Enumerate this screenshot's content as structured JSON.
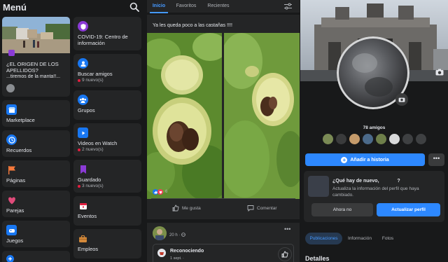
{
  "menu": {
    "title": "Menú",
    "news_card": {
      "title": "¿EL ORIGEN DE LOS APELLIDOS?",
      "subtitle": "...tiremos de la manta!!..."
    },
    "cards_left": [
      {
        "label": "Marketplace",
        "icon": "marketplace-icon"
      },
      {
        "label": "Recuerdos",
        "icon": "memories-icon"
      },
      {
        "label": "Páginas",
        "icon": "pages-flag-icon"
      },
      {
        "label": "Parejas",
        "icon": "dating-heart-icon"
      },
      {
        "label": "Juegos",
        "icon": "gaming-icon"
      }
    ],
    "cards_right": [
      {
        "label": "COVID-19: Centro de información",
        "icon": "covid-info-icon",
        "sub": ""
      },
      {
        "label": "Buscar amigos",
        "icon": "find-friends-icon",
        "sub": "9 nuevo(s)"
      },
      {
        "label": "Grupos",
        "icon": "groups-icon",
        "sub": ""
      },
      {
        "label": "Videos en Watch",
        "icon": "watch-video-icon",
        "sub": "2 nuevo(s)"
      },
      {
        "label": "Guardado",
        "icon": "saved-bookmark-icon",
        "sub": "3 nuevo(s)"
      },
      {
        "label": "Eventos",
        "icon": "events-calendar-icon",
        "sub": ""
      },
      {
        "label": "Empleos",
        "icon": "jobs-briefcase-icon",
        "sub": ""
      }
    ]
  },
  "feed": {
    "tabs": [
      "Inicio",
      "Favoritos",
      "Recientes"
    ],
    "post1": {
      "text": "Ya les queda poco a las castañas !!!!",
      "reaction_count": "6",
      "like_label": "Me gusta",
      "comment_label": "Comentar"
    },
    "post2": {
      "time": "20 h ·",
      "more": "•••",
      "shared_title": "Reconociendo",
      "shared_date": "1 sept. ·"
    }
  },
  "profile": {
    "friends_count": "78 amigos",
    "add_story_label": "Añadir a historia",
    "more_label": "•••",
    "update_title": "¿Qué hay de nuevo,",
    "update_title_end": "?",
    "update_desc": "Actualiza la información del perfil que haya cambiado.",
    "later_label": "Ahora no",
    "update_label": "Actualizar perfil",
    "tabs": [
      "Publicaciones",
      "Información",
      "Fotos"
    ],
    "details_heading": "Detalles"
  },
  "colors": {
    "background": "#18191a",
    "card": "#242526",
    "accent": "#2d88ff",
    "link": "#4599ff",
    "notification": "#e41e3f"
  }
}
